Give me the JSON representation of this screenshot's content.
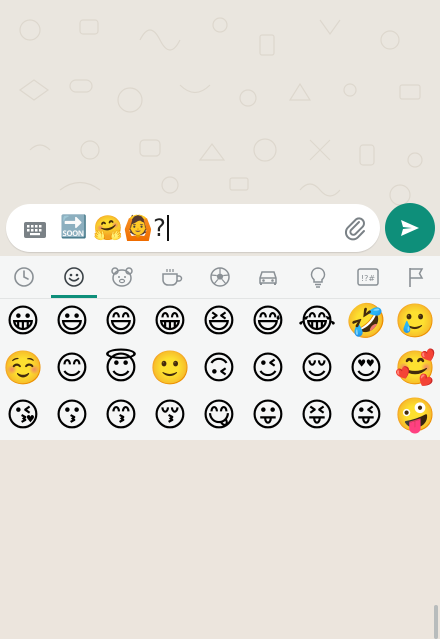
{
  "composer": {
    "message_emojis": "🤗🙆",
    "soon_arrow": "🔜",
    "question_mark": "?"
  },
  "emoji_tabs": [
    {
      "name": "recent-icon",
      "symbol": "◷"
    },
    {
      "name": "smileys-icon",
      "symbol": "☺",
      "selected": true
    },
    {
      "name": "animals-icon",
      "symbol": "🐻"
    },
    {
      "name": "food-icon",
      "symbol": "☕"
    },
    {
      "name": "activities-icon",
      "symbol": "⚽"
    },
    {
      "name": "travel-icon",
      "symbol": "🚗"
    },
    {
      "name": "objects-icon",
      "symbol": "💡"
    },
    {
      "name": "symbols-icon",
      "symbol": "!?#"
    },
    {
      "name": "flags-icon",
      "symbol": "⚑"
    }
  ],
  "emoji_rows": [
    [
      "😀",
      "😃",
      "😄",
      "😁",
      "😆",
      "😅",
      "😂",
      "🤣",
      "🥲"
    ],
    [
      "☺️",
      "😊",
      "😇",
      "🙂",
      "🙃",
      "😉",
      "😌",
      "😍",
      "🥰"
    ],
    [
      "😘",
      "😗",
      "😙",
      "😚",
      "😋",
      "😛",
      "😝",
      "😜",
      "🤪"
    ]
  ],
  "colors": {
    "accent": "#0E8F7A",
    "chat_background": "#EAE6DF",
    "panel_background": "#F5F6F6"
  }
}
